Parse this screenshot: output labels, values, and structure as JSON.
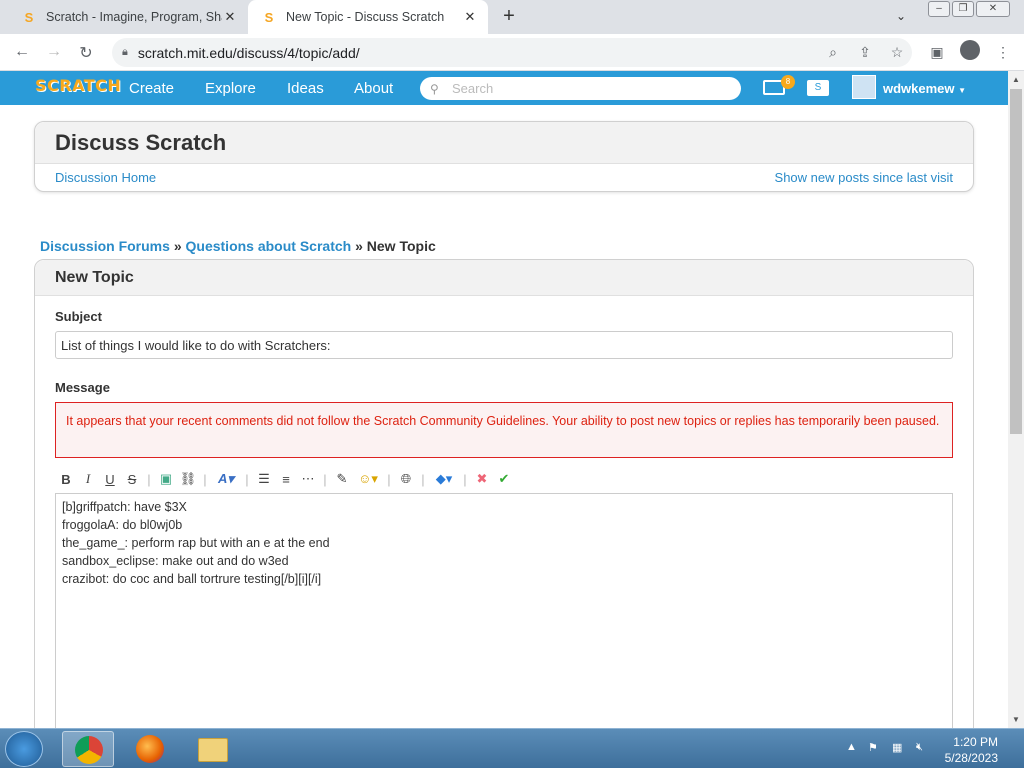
{
  "browser": {
    "tabs": [
      {
        "title": "Scratch - Imagine, Program, Share",
        "active": false
      },
      {
        "title": "New Topic - Discuss Scratch",
        "active": true
      }
    ],
    "url": "scratch.mit.edu/discuss/4/topic/add/"
  },
  "site": {
    "logo": "SCRATCH",
    "nav": [
      "Create",
      "Explore",
      "Ideas",
      "About"
    ],
    "search_placeholder": "Search",
    "messages_count": "8",
    "username": "wdwkemew"
  },
  "discuss": {
    "title": "Discuss Scratch",
    "home_link": "Discussion Home",
    "new_posts_link": "Show new posts since last visit"
  },
  "breadcrumb": {
    "forums": "Discussion Forums",
    "sep": "»",
    "category": "Questions about Scratch",
    "current": "New Topic"
  },
  "form": {
    "heading": "New Topic",
    "subject_label": "Subject",
    "subject_value": "List of things I would like to do with Scratchers:",
    "message_label": "Message",
    "error": "It appears that your recent comments did not follow the Scratch Community Guidelines. Your ability to post new topics or replies has temporarily been paused.",
    "message_value": "[b]griffpatch: have $3X\nfroggolaA: do bl0wj0b\nthe_game_: perform rap but with an e at the end\nsandbox_eclipse: make out and do w3ed\ncrazibot: do coc and ball tortrure testing[/b][i][/i]"
  },
  "taskbar": {
    "time": "1:20 PM",
    "date": "5/28/2023"
  },
  "colors": {
    "scratch_blue": "#2a9bd8",
    "link": "#2a8bc8",
    "error_red": "#dd2211"
  }
}
